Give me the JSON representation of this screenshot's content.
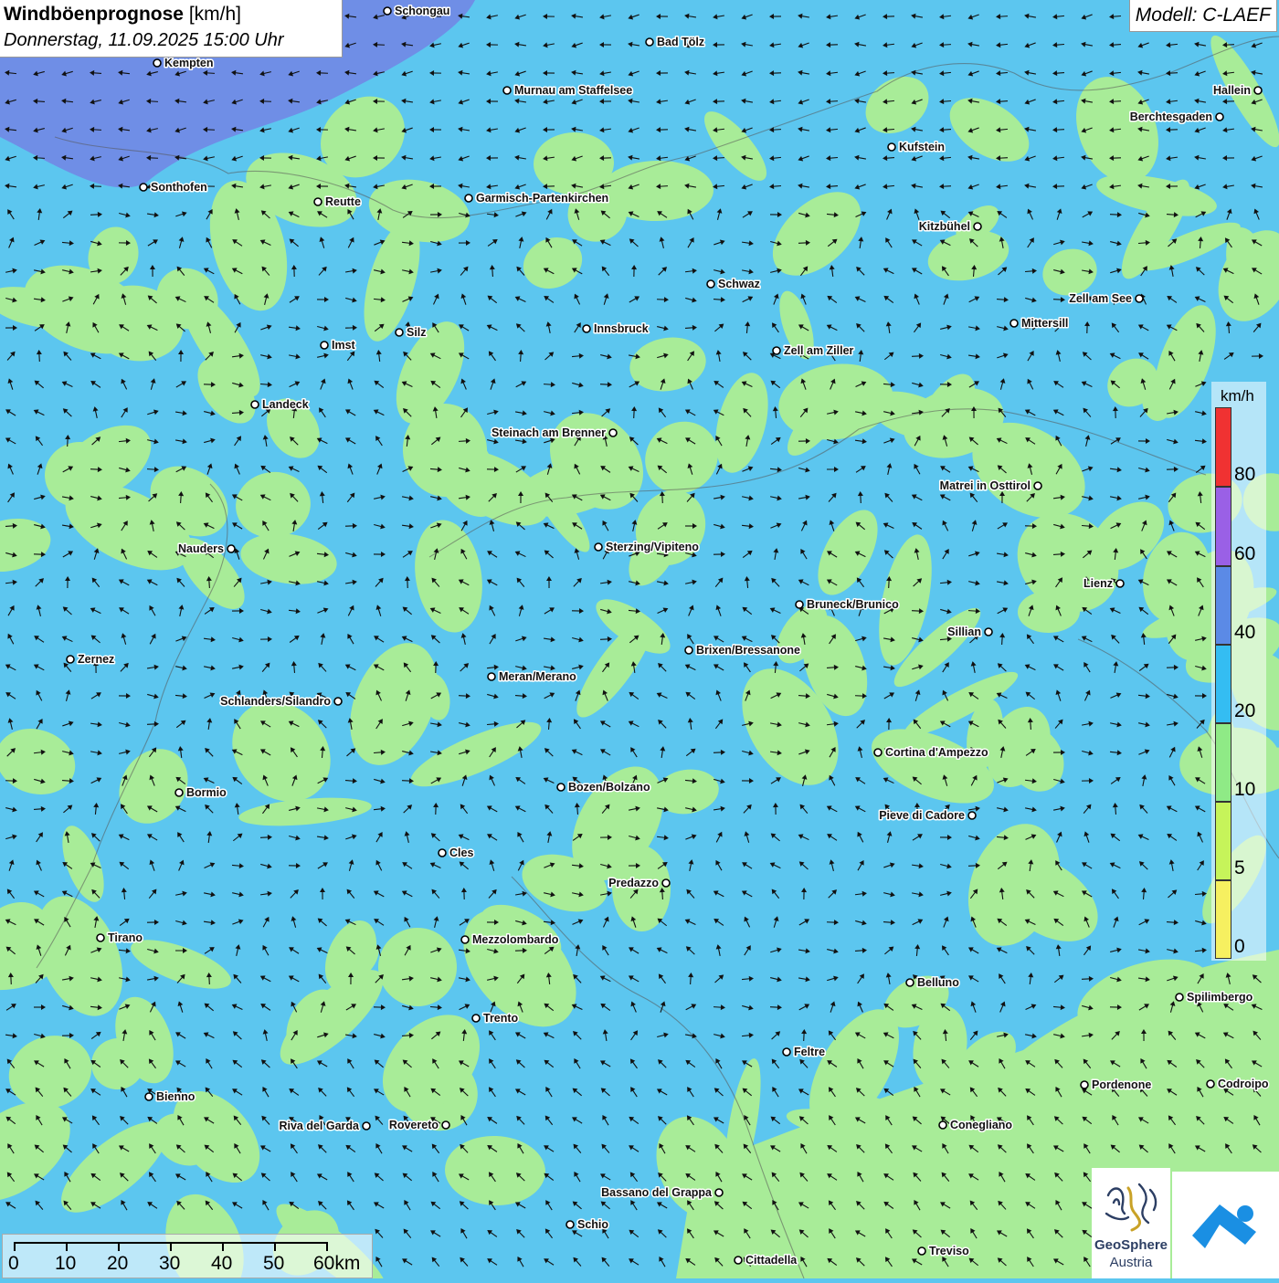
{
  "header": {
    "title": "Windböenprognose",
    "unit": "[km/h]",
    "datetime": "Donnerstag, 11.09.2025 15:00 Uhr"
  },
  "model": {
    "label": "Modell: C-LAEF"
  },
  "legend": {
    "unit": "km/h",
    "labels": [
      "80",
      "60",
      "40",
      "20",
      "10",
      "5",
      "0"
    ],
    "colors": [
      "#f03232",
      "#9a60e6",
      "#5b8ae6",
      "#34bdf2",
      "#8fea86",
      "#c6f45a",
      "#f6f060"
    ]
  },
  "colors": {
    "very_low": "#a8ec98",
    "low": "#5cc6ef",
    "moderate": "#6f8ee6",
    "border": "#555555"
  },
  "scale_bar": {
    "labels": [
      "0",
      "10",
      "20",
      "30",
      "40",
      "50",
      "60km"
    ]
  },
  "logo": {
    "name": "GeoSphere",
    "sub": "Austria"
  },
  "cities": [
    {
      "name": "Schongau"
    },
    {
      "name": "Bad Tölz"
    },
    {
      "name": "Kempten"
    },
    {
      "name": "Murnau am Staffelsee"
    },
    {
      "name": "Hallein"
    },
    {
      "name": "Berchtesgaden"
    },
    {
      "name": "Kufstein"
    },
    {
      "name": "Sonthofen"
    },
    {
      "name": "Reutte"
    },
    {
      "name": "Garmisch-Partenkirchen"
    },
    {
      "name": "Kitzbühel"
    },
    {
      "name": "Schwaz"
    },
    {
      "name": "Zell am See"
    },
    {
      "name": "Mittersill"
    },
    {
      "name": "Silz"
    },
    {
      "name": "Innsbruck"
    },
    {
      "name": "Imst"
    },
    {
      "name": "Zell am Ziller"
    },
    {
      "name": "Landeck"
    },
    {
      "name": "Steinach am Brenner"
    },
    {
      "name": "Matrei in Osttirol"
    },
    {
      "name": "Nauders"
    },
    {
      "name": "Sterzing/Vipiteno"
    },
    {
      "name": "Lienz"
    },
    {
      "name": "Bruneck/Brunico"
    },
    {
      "name": "Sillian"
    },
    {
      "name": "Brixen/Bressanone"
    },
    {
      "name": "Zernez"
    },
    {
      "name": "Meran/Merano"
    },
    {
      "name": "Schlanders/Silandro"
    },
    {
      "name": "Cortina d'Ampezzo"
    },
    {
      "name": "Bozen/Bolzano"
    },
    {
      "name": "Bormio"
    },
    {
      "name": "Pieve di Cadore"
    },
    {
      "name": "Cles"
    },
    {
      "name": "Predazzo"
    },
    {
      "name": "Tirano"
    },
    {
      "name": "Mezzolombardo"
    },
    {
      "name": "Belluno"
    },
    {
      "name": "Spilimbergo"
    },
    {
      "name": "Trento"
    },
    {
      "name": "Feltre"
    },
    {
      "name": "Bienno"
    },
    {
      "name": "Pordenone"
    },
    {
      "name": "Codroipo"
    },
    {
      "name": "Riva del Garda"
    },
    {
      "name": "Rovereto"
    },
    {
      "name": "Conegliano"
    },
    {
      "name": "Bassano del Grappa"
    },
    {
      "name": "Schio"
    },
    {
      "name": "Treviso"
    },
    {
      "name": "Cittadella"
    }
  ]
}
